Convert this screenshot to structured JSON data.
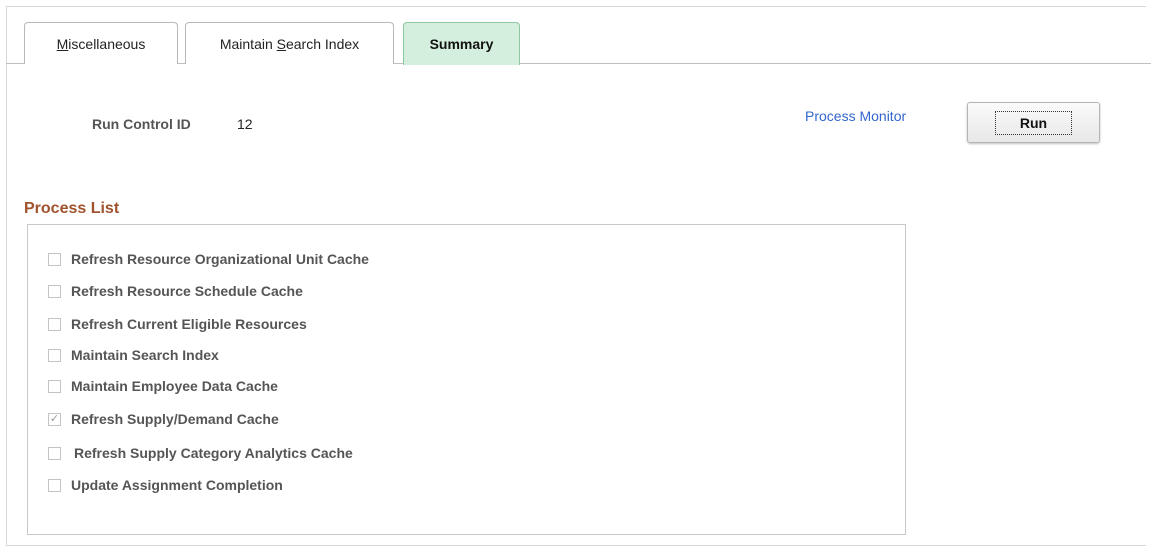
{
  "tabs": [
    {
      "label_pre": "",
      "label_accel": "M",
      "label_post": "iscellaneous",
      "active": false
    },
    {
      "label_pre": "Maintain ",
      "label_accel": "S",
      "label_post": "earch Index",
      "active": false
    },
    {
      "label_pre": "Summary",
      "label_accel": "",
      "label_post": "",
      "active": true
    }
  ],
  "run_control": {
    "label": "Run Control ID",
    "value": "12"
  },
  "process_monitor_link": "Process Monitor",
  "run_button": "Run",
  "process_list": {
    "title": "Process List",
    "items": [
      {
        "label": "Refresh Resource Organizational Unit Cache",
        "checked": false
      },
      {
        "label": "Refresh Resource Schedule Cache",
        "checked": false
      },
      {
        "label": "Refresh Current Eligible Resources",
        "checked": false
      },
      {
        "label": "Maintain Search Index",
        "checked": false
      },
      {
        "label": "Maintain Employee Data Cache",
        "checked": false
      },
      {
        "label": "Refresh Supply/Demand Cache",
        "checked": true
      },
      {
        "label": "Refresh Supply Category Analytics Cache",
        "checked": false
      },
      {
        "label": "Update Assignment Completion",
        "checked": false
      }
    ]
  },
  "colors": {
    "active_tab_bg": "#d5efdf",
    "section_title": "#a0522d",
    "link": "#3366cc"
  }
}
